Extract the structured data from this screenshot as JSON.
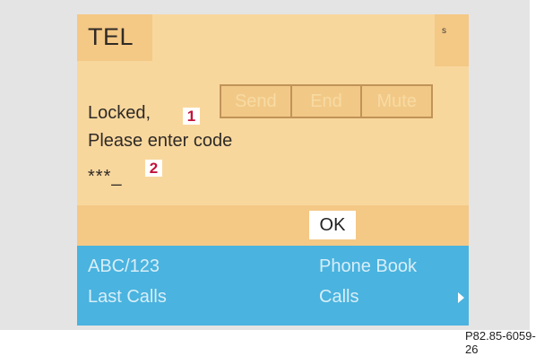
{
  "screen": {
    "title": "TEL",
    "signal": "s"
  },
  "softkeys": [
    {
      "label": "Send"
    },
    {
      "label": "End"
    },
    {
      "label": "Mute"
    }
  ],
  "message": {
    "line1": "Locked,",
    "line2": "Please enter code",
    "code_entry": "***_"
  },
  "callouts": [
    "1",
    "2"
  ],
  "ok_label": "OK",
  "menu": {
    "top_left": "ABC/123",
    "top_right": "Phone Book",
    "bottom_left": "Last Calls",
    "bottom_right": "Calls",
    "arrow_icon": "arrow-right-icon"
  },
  "figure_ref": "P82.85-6059-26",
  "colors": {
    "screen_bg": "#f8d79d",
    "tab_bg": "#f4c885",
    "menu_bg": "#4ab3df",
    "callout_text": "#c2123a"
  }
}
